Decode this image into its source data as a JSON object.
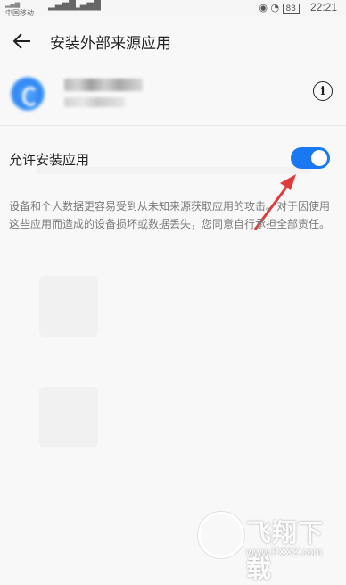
{
  "status_bar": {
    "carrier": "中国移动",
    "time": "22:21",
    "battery_icon": "battery-icon",
    "signal_icon": "signal-icon",
    "wifi_icon": "wifi-icon",
    "alarm_icon": "alarm-icon",
    "eye_icon": "eye-icon"
  },
  "app_bar": {
    "back_icon": "arrow-left-icon",
    "title": "安装外部来源应用"
  },
  "app_info": {
    "icon": "app-icon",
    "info_icon": "info-icon",
    "info_glyph": "i"
  },
  "setting": {
    "label": "允许安装应用",
    "enabled": true,
    "toggle_color": "#1a78f2"
  },
  "warning": {
    "text": "设备和个人数据更容易受到从未知来源获取应用的攻击。对于因使用这些应用而造成的设备损坏或数据丢失，您同意自行承担全部责任。"
  },
  "watermark": {
    "text": "飞翔下载",
    "url": "www.FXXZ.com"
  },
  "colors": {
    "accent": "#1a78f2",
    "annotation_arrow": "#e03b3b",
    "background": "#f8f8f8"
  }
}
